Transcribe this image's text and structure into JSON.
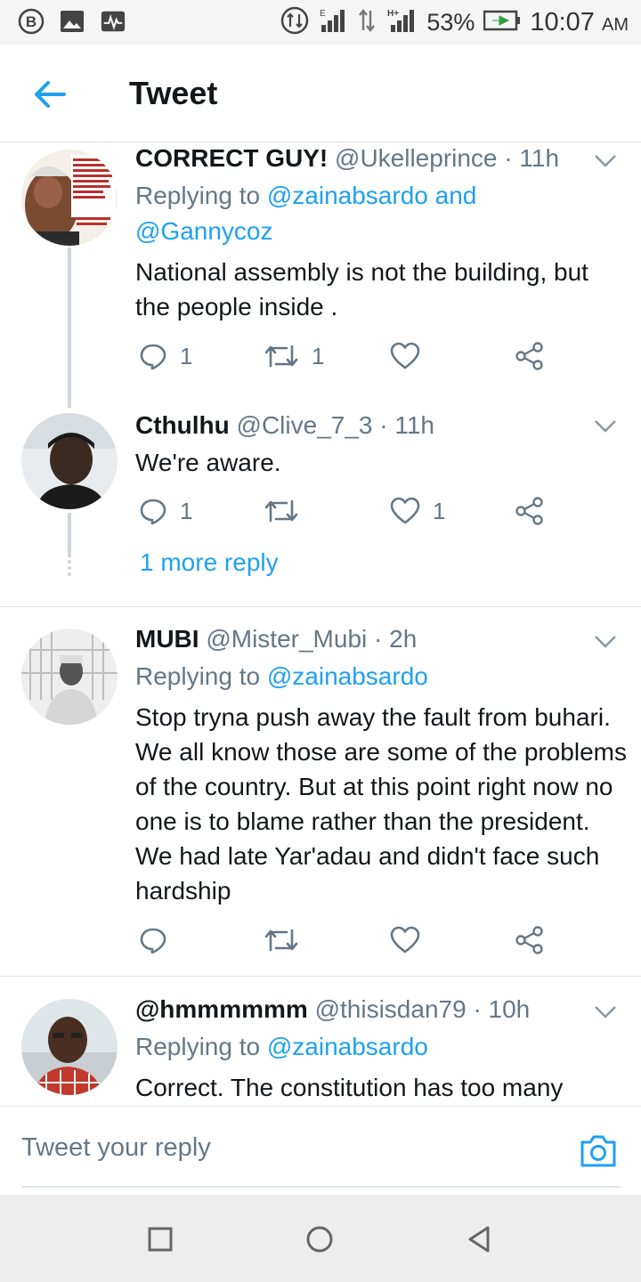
{
  "status_bar": {
    "battery": "53%",
    "time": "10:07",
    "ampm": "AM",
    "icons": [
      "b-icon",
      "image-icon",
      "pulse-icon",
      "data-icon",
      "signal-icon",
      "transfer-icon",
      "hplus-signal-icon",
      "battery-icon"
    ]
  },
  "header": {
    "title": "Tweet",
    "back_icon": "arrow-left-icon"
  },
  "tweets": [
    {
      "name": "CORRECT GUY!",
      "handle": "@Ukelleprince",
      "time": "· 11h",
      "reply_prefix": "Replying to ",
      "reply_to_1": "@zainabsardo",
      "reply_and": " and",
      "reply_to_2": "@Gannycoz",
      "text": "National assembly is not the building, but the people inside .",
      "replies": "1",
      "retweets": "1",
      "likes": "",
      "avatar_text": "\"I want to ask you that by the time he (Buhari) takes over, petrol will be dispensed at N40 per litre.\" -Tam David-West PUNCH Newspaper April 14, 2019"
    },
    {
      "name": "Cthulhu",
      "handle": "@Clive_7_3",
      "time": "· 11h",
      "text": "We're aware.",
      "replies": "1",
      "retweets": "",
      "likes": "1"
    },
    {
      "more_replies": "1 more reply"
    },
    {
      "name": "MUBI",
      "handle": "@Mister_Mubi",
      "time": "· 2h",
      "reply_prefix": "Replying to ",
      "reply_to_1": "@zainabsardo",
      "text": "Stop tryna push away the fault from buhari. We all know those are some of the problems of the country. But at this point right now no one is to blame rather than the president. We had late Yar'adau and didn't face such hardship",
      "replies": "",
      "retweets": "",
      "likes": ""
    },
    {
      "name": "@hmmmmmm",
      "handle": "@thisisdan79",
      "time": "· 10h",
      "reply_prefix": "Replying to ",
      "reply_to_1": "@zainabsardo",
      "text": "Correct. The constitution has too many"
    }
  ],
  "compose": {
    "placeholder": "Tweet your reply",
    "camera_icon": "camera-icon"
  },
  "nav": {
    "icons": [
      "recents-square-icon",
      "home-circle-icon",
      "back-triangle-icon"
    ]
  },
  "colors": {
    "accent": "#1da1f2",
    "muted": "#657786",
    "text": "#14171a",
    "divider": "#dfe3e7"
  }
}
